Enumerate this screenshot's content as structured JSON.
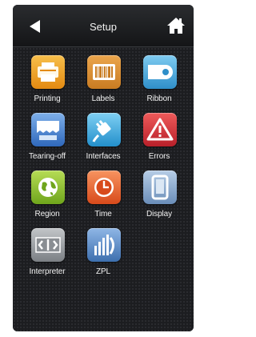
{
  "header": {
    "title": "Setup",
    "back_icon": "back-arrow-icon",
    "home_icon": "home-icon"
  },
  "menu": {
    "items": [
      {
        "label": "Printing",
        "icon": "printer-icon",
        "color": "#f0a21d"
      },
      {
        "label": "Labels",
        "icon": "barcode-label-icon",
        "color": "#d98d2c"
      },
      {
        "label": "Ribbon",
        "icon": "ribbon-roll-icon",
        "color": "#4aa9dd"
      },
      {
        "label": "Tearing-off",
        "icon": "tear-off-icon",
        "color": "#3f7fd0"
      },
      {
        "label": "Interfaces",
        "icon": "plug-icon",
        "color": "#3ea4d9"
      },
      {
        "label": "Errors",
        "icon": "warning-icon",
        "color": "#d4343a"
      },
      {
        "label": "Region",
        "icon": "globe-icon",
        "color": "#8cbf2b"
      },
      {
        "label": "Time",
        "icon": "clock-icon",
        "color": "#e75e2b"
      },
      {
        "label": "Display",
        "icon": "display-icon",
        "color": "#8aa7c9"
      },
      {
        "label": "Interpreter",
        "icon": "interpreter-icon",
        "color": "#9a9ea3"
      },
      {
        "label": "ZPL",
        "icon": "zpl-icon",
        "color": "#5d8fc9"
      }
    ]
  }
}
